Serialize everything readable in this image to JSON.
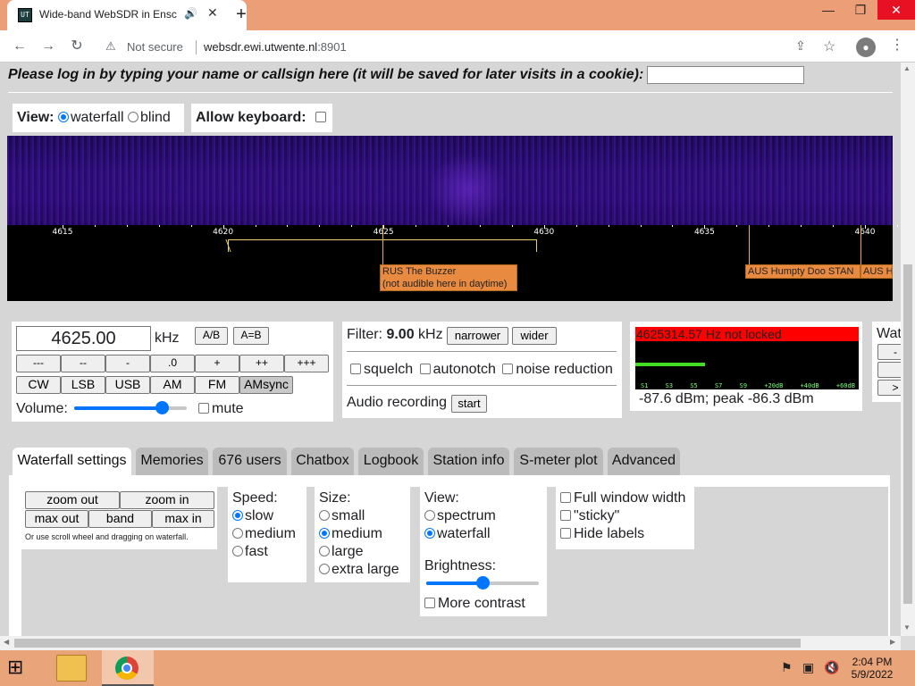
{
  "browser": {
    "tab_title": "Wide-band WebSDR in Ensc",
    "favicon_text": "UT",
    "new_tab": "+",
    "security_label": "Not secure",
    "url_host": "websdr.ewi.utwente.nl",
    "url_port": ":8901"
  },
  "page": {
    "login_prompt": "Please log in by typing your name or callsign here (it will be saved for later visits in a cookie):",
    "view_label": "View:",
    "view_options": [
      "waterfall",
      "blind"
    ],
    "allow_keyboard_label": "Allow keyboard:"
  },
  "scale": {
    "ticks": [
      {
        "label": "4615",
        "pos": 62
      },
      {
        "label": "4620",
        "pos": 242
      },
      {
        "label": "4625",
        "pos": 421
      },
      {
        "label": "4630",
        "pos": 601
      },
      {
        "label": "4635",
        "pos": 781
      },
      {
        "label": "4640",
        "pos": 960
      }
    ],
    "stations": [
      {
        "name": "RUS The Buzzer",
        "note": "(not audible here in daytime)"
      },
      {
        "name": "AUS Humpty Doo STAN"
      },
      {
        "name": "AUS Hu"
      }
    ]
  },
  "tuning": {
    "frequency": "4625.00",
    "unit": "kHz",
    "ab": "A/B",
    "a_eq_b": "A=B",
    "steps": [
      "---",
      "--",
      "-",
      ".0",
      "+",
      "++",
      "+++"
    ],
    "modes": [
      "CW",
      "LSB",
      "USB",
      "AM",
      "FM",
      "AMsync"
    ],
    "active_mode": "AMsync",
    "volume_label": "Volume:",
    "volume_level": 0.78,
    "mute_label": "mute"
  },
  "filter": {
    "label": "Filter:",
    "bandwidth": "9.00",
    "unit": "kHz",
    "narrower": "narrower",
    "wider": "wider",
    "options": [
      "squelch",
      "autonotch",
      "noise reduction"
    ],
    "recording_label": "Audio recording",
    "start": "start"
  },
  "smeter": {
    "status": "4625314.57 Hz not locked",
    "scale": [
      "S1",
      "S3",
      "S5",
      "S7",
      "S9",
      "+20dB",
      "+40dB",
      "+60dB"
    ],
    "level_text": "-87.6 dBm; peak  -86.3 dBm"
  },
  "wat_panel": {
    "title": "Wat",
    "buttons": [
      "-",
      "",
      ">"
    ]
  },
  "tabs": [
    "Waterfall settings",
    "Memories",
    "676 users",
    "Chatbox",
    "Logbook",
    "Station info",
    "S-meter plot",
    "Advanced"
  ],
  "active_tab": "Waterfall settings",
  "waterfall_settings": {
    "zoom_out": "zoom out",
    "zoom_in": "zoom in",
    "max_out": "max out",
    "band": "band",
    "max_in": "max in",
    "hint": "Or use scroll wheel and dragging on waterfall.",
    "speed_label": "Speed:",
    "speed_options": [
      "slow",
      "medium",
      "fast"
    ],
    "speed_selected": "slow",
    "size_label": "Size:",
    "size_options": [
      "small",
      "medium",
      "large",
      "extra large"
    ],
    "size_selected": "medium",
    "view_label": "View:",
    "view_options": [
      "spectrum",
      "waterfall"
    ],
    "view_selected": "waterfall",
    "brightness_label": "Brightness:",
    "brightness_level": 0.5,
    "more_contrast": "More contrast",
    "checkboxes": [
      "Full window width",
      "\"sticky\"",
      "Hide labels"
    ]
  },
  "taskbar": {
    "time": "2:04 PM",
    "date": "5/9/2022"
  }
}
